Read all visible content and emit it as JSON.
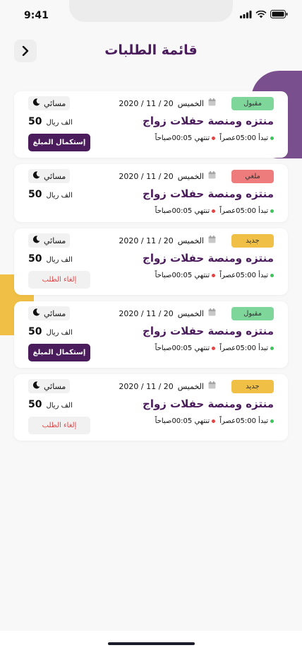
{
  "status": {
    "time": "9:41"
  },
  "header": {
    "title": "قائمة الطلبات"
  },
  "colors": {
    "primary": "#4b1c5c",
    "accepted": "#7ed69b",
    "cancelled": "#ee7c7c",
    "new": "#f0bf45",
    "start_dot": "#3cc55a",
    "end_dot": "#e24545"
  },
  "orders": [
    {
      "status": "مقبول",
      "status_type": "accepted",
      "day": "الخميس",
      "date": "2020 / 11 / 20",
      "shift": "مسائي",
      "title": "منتزه ومنصة حفلات زواج",
      "start": "تبدأ 05:00عصراً",
      "end": "تنتهي 00:05صباحاً",
      "price": "50",
      "currency": "الف ريال",
      "action": "إستكمال المبلغ",
      "action_type": "complete"
    },
    {
      "status": "ملغي",
      "status_type": "cancelled",
      "day": "الخميس",
      "date": "2020 / 11 / 20",
      "shift": "مسائي",
      "title": "منتزه ومنصة حفلات زواج",
      "start": "تبدأ 05:00عصراً",
      "end": "تنتهي 00:05صباحاً",
      "price": "50",
      "currency": "الف ريال",
      "action": "",
      "action_type": "none"
    },
    {
      "status": "جديد",
      "status_type": "new",
      "day": "الخميس",
      "date": "2020 / 11 / 20",
      "shift": "مسائي",
      "title": "منتزه ومنصة حفلات زواج",
      "start": "تبدأ 05:00عصراً",
      "end": "تنتهي 00:05صباحاً",
      "price": "50",
      "currency": "الف ريال",
      "action": "إلغاء الطلب",
      "action_type": "cancel"
    },
    {
      "status": "مقبول",
      "status_type": "accepted",
      "day": "الخميس",
      "date": "2020 / 11 / 20",
      "shift": "مسائي",
      "title": "منتزه ومنصة حفلات زواج",
      "start": "تبدأ 05:00عصراً",
      "end": "تنتهي 00:05صباحاً",
      "price": "50",
      "currency": "الف ريال",
      "action": "إستكمال المبلغ",
      "action_type": "complete"
    },
    {
      "status": "جديد",
      "status_type": "new",
      "day": "الخميس",
      "date": "2020 / 11 / 20",
      "shift": "مسائي",
      "title": "منتزه ومنصة حفلات زواج",
      "start": "تبدأ 05:00عصراً",
      "end": "تنتهي 00:05صباحاً",
      "price": "50",
      "currency": "الف ريال",
      "action": "إلغاء الطلب",
      "action_type": "cancel"
    }
  ]
}
